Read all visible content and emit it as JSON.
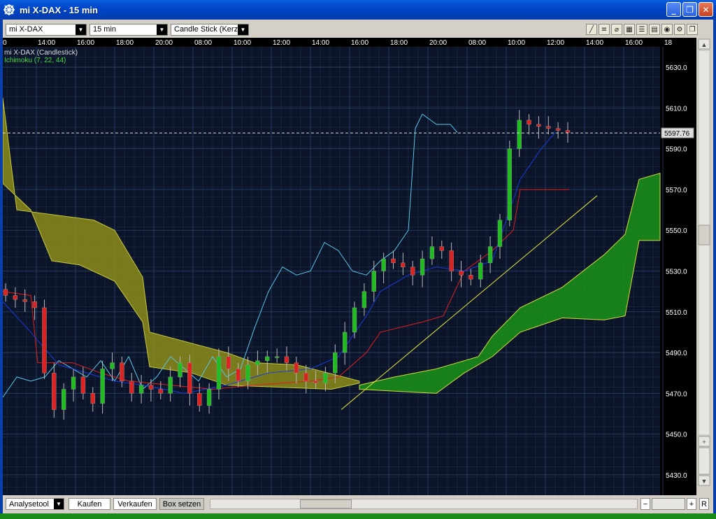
{
  "window": {
    "title": "mi X-DAX - 15 min",
    "buttons": {
      "minimize": "_",
      "maximize": "❐",
      "close": "✕"
    }
  },
  "toolbar": {
    "instrument": "mi X-DAX",
    "interval": "15 min",
    "chart_type": "Candle Stick (Kerze"
  },
  "chart": {
    "series_label": "mi X-DAX (Candlestick)",
    "indicator_label": "Ichimoku (7, 22, 44)",
    "time_labels": [
      "0",
      "14:00",
      "16:00",
      "18:00",
      "20:00",
      "08:00",
      "10:00",
      "12:00",
      "14:00",
      "16:00",
      "18:00",
      "20:00",
      "08:00",
      "10:00",
      "12:00",
      "14:00",
      "16:00",
      "18"
    ],
    "price_labels": [
      "5630.0",
      "5610.0",
      "5590.0",
      "5570.0",
      "5550.0",
      "5530.0",
      "5510.0",
      "5490.0",
      "5470.0",
      "5450.0",
      "5430.0"
    ],
    "current_price": "5597.76",
    "colors": {
      "background": "#0b1428",
      "grid": "#1f3350",
      "bull": "#22bb22",
      "bear": "#dd2222",
      "kumo_bear": "#8c8c1a",
      "kumo_bull": "#1a8c1a",
      "chikou": "#58c8e8",
      "tenkan": "#1a3ae0",
      "kijun": "#e02020",
      "trendline": "#e8e840"
    }
  },
  "chart_data": {
    "type": "line",
    "title": "mi X-DAX (Candlestick)",
    "ylim": [
      5420,
      5640
    ],
    "y_ticks": [
      5630,
      5610,
      5590,
      5570,
      5550,
      5530,
      5510,
      5490,
      5470,
      5450,
      5430
    ],
    "last_price": 5597.76,
    "series": [
      {
        "name": "mi X-DAX (Candlestick)",
        "values": [
          5518,
          5516,
          5515,
          5512,
          5480,
          5462,
          5472,
          5478,
          5470,
          5465,
          5482,
          5485,
          5476,
          5470,
          5474,
          5472,
          5470,
          5478,
          5485,
          5470,
          5464,
          5472,
          5488,
          5482,
          5476,
          5484,
          5486,
          5488,
          5488,
          5485,
          5480,
          5476,
          5475,
          5480,
          5490,
          5500,
          5512,
          5520,
          5530,
          5536,
          5534,
          5532,
          5528,
          5536,
          5542,
          5540,
          5530,
          5528,
          5526,
          5534,
          5542,
          5555,
          5590,
          5604,
          5602,
          5601,
          5600,
          5599,
          5598
        ]
      },
      {
        "name": "Ichimoku (7, 22, 44)",
        "values": []
      }
    ]
  },
  "bottombar": {
    "analysetool": "Analysetool",
    "kaufen": "Kaufen",
    "verkaufen": "Verkaufen",
    "box_setzen": "Box setzen",
    "r_button": "R"
  }
}
